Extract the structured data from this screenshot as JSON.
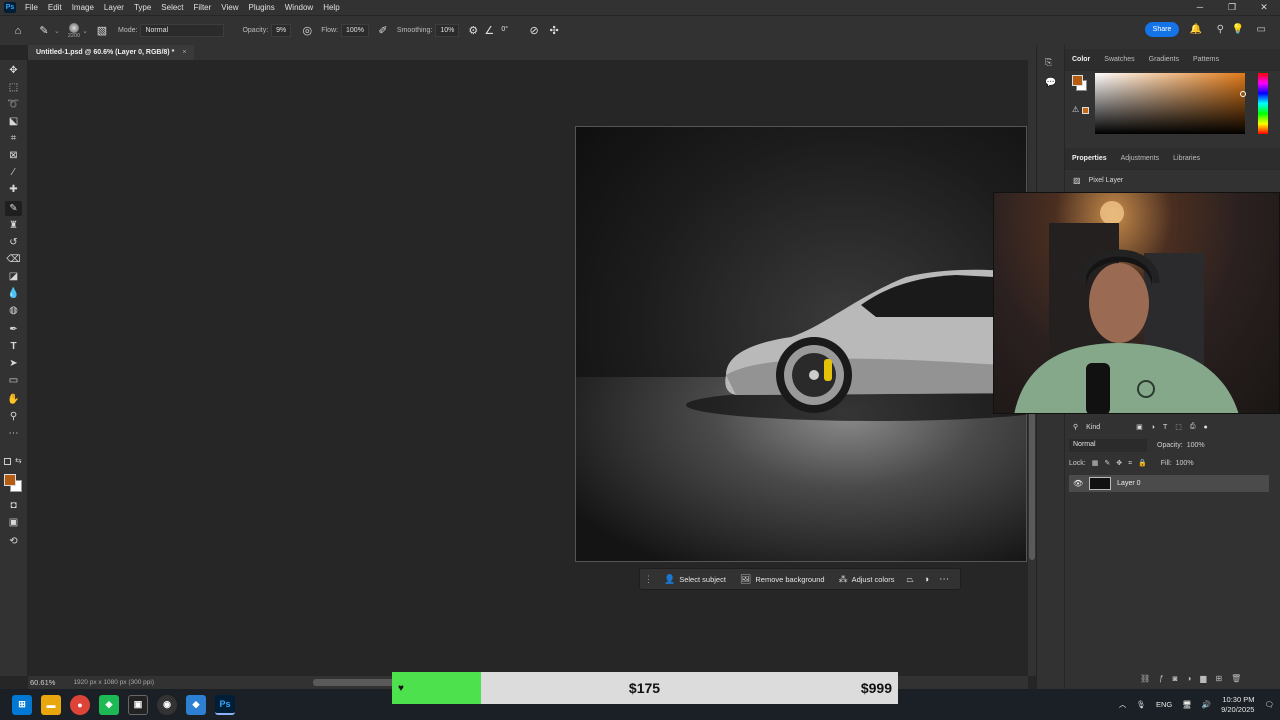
{
  "menu": [
    "File",
    "Edit",
    "Image",
    "Layer",
    "Type",
    "Select",
    "Filter",
    "View",
    "Plugins",
    "Window",
    "Help"
  ],
  "app_icon": "Ps",
  "window_controls": {
    "minimize": "─",
    "restore": "❐",
    "close": "✕"
  },
  "options": {
    "brush_size": "2200",
    "mode_label": "Mode:",
    "mode_value": "Normal",
    "opacity_label": "Opacity:",
    "opacity_value": "9%",
    "flow_label": "Flow:",
    "flow_value": "100%",
    "smoothing_label": "Smoothing:",
    "smoothing_value": "10%",
    "angle_value": "0°",
    "share_label": "Share"
  },
  "document_tab": {
    "title": "Untitled-1.psd @ 60.6% (Layer 0, RGB/8) *",
    "close": "×"
  },
  "status": {
    "zoom": "60.61%",
    "doc_info": "1920 px x 1080 px (300 ppi)"
  },
  "context_bar": {
    "select_subject": "Select subject",
    "remove_background": "Remove background",
    "adjust_colors": "Adjust colors"
  },
  "color_panel": {
    "tabs": [
      "Color",
      "Swatches",
      "Gradients",
      "Patterns"
    ],
    "foreground": "#b35c12",
    "background": "#ffffff"
  },
  "properties_panel": {
    "tabs": [
      "Properties",
      "Adjustments",
      "Libraries"
    ],
    "type_label": "Pixel Layer"
  },
  "layers_panel": {
    "filter_label": "Kind",
    "blend_mode": "Normal",
    "opacity_label": "Opacity:",
    "opacity_value": "100%",
    "lock_label": "Lock:",
    "fill_label": "Fill:",
    "fill_value": "100%",
    "layers": [
      {
        "name": "Layer 0",
        "visible": true
      }
    ]
  },
  "price_overlay": {
    "current": "$175",
    "goal": "$999",
    "progress": 0.175
  },
  "tray": {
    "lang": "ENG",
    "time": "10:30 PM",
    "date": "9/20/2025"
  }
}
